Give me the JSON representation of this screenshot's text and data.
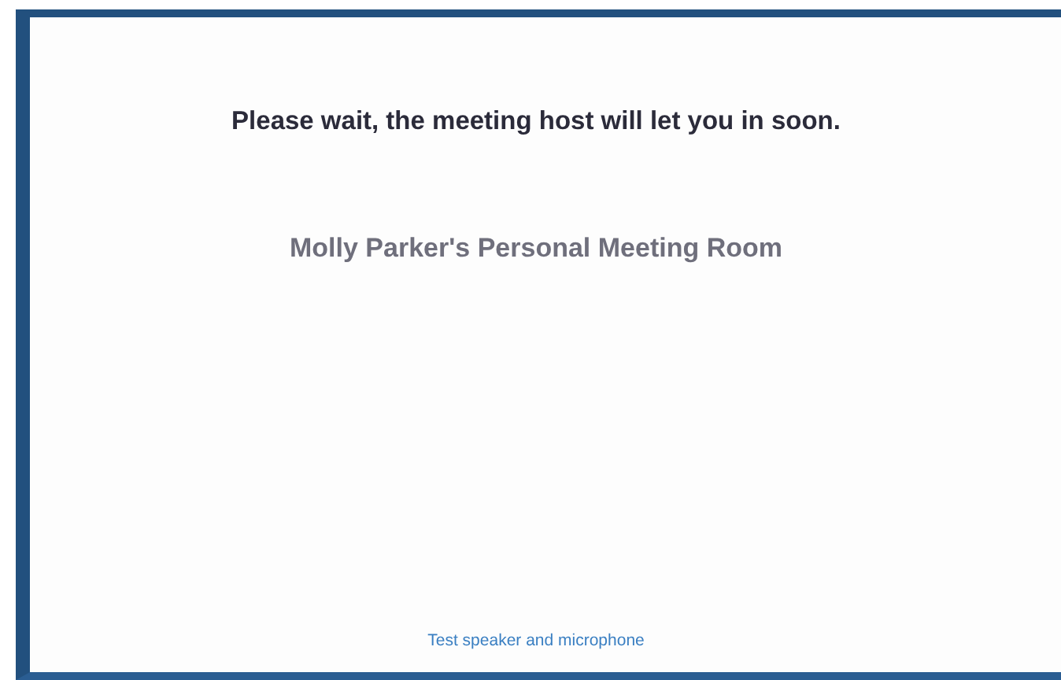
{
  "message": "Please wait, the meeting host will let you in soon.",
  "meeting_name": "Molly Parker's Personal Meeting Room",
  "test_link": "Test speaker and microphone"
}
